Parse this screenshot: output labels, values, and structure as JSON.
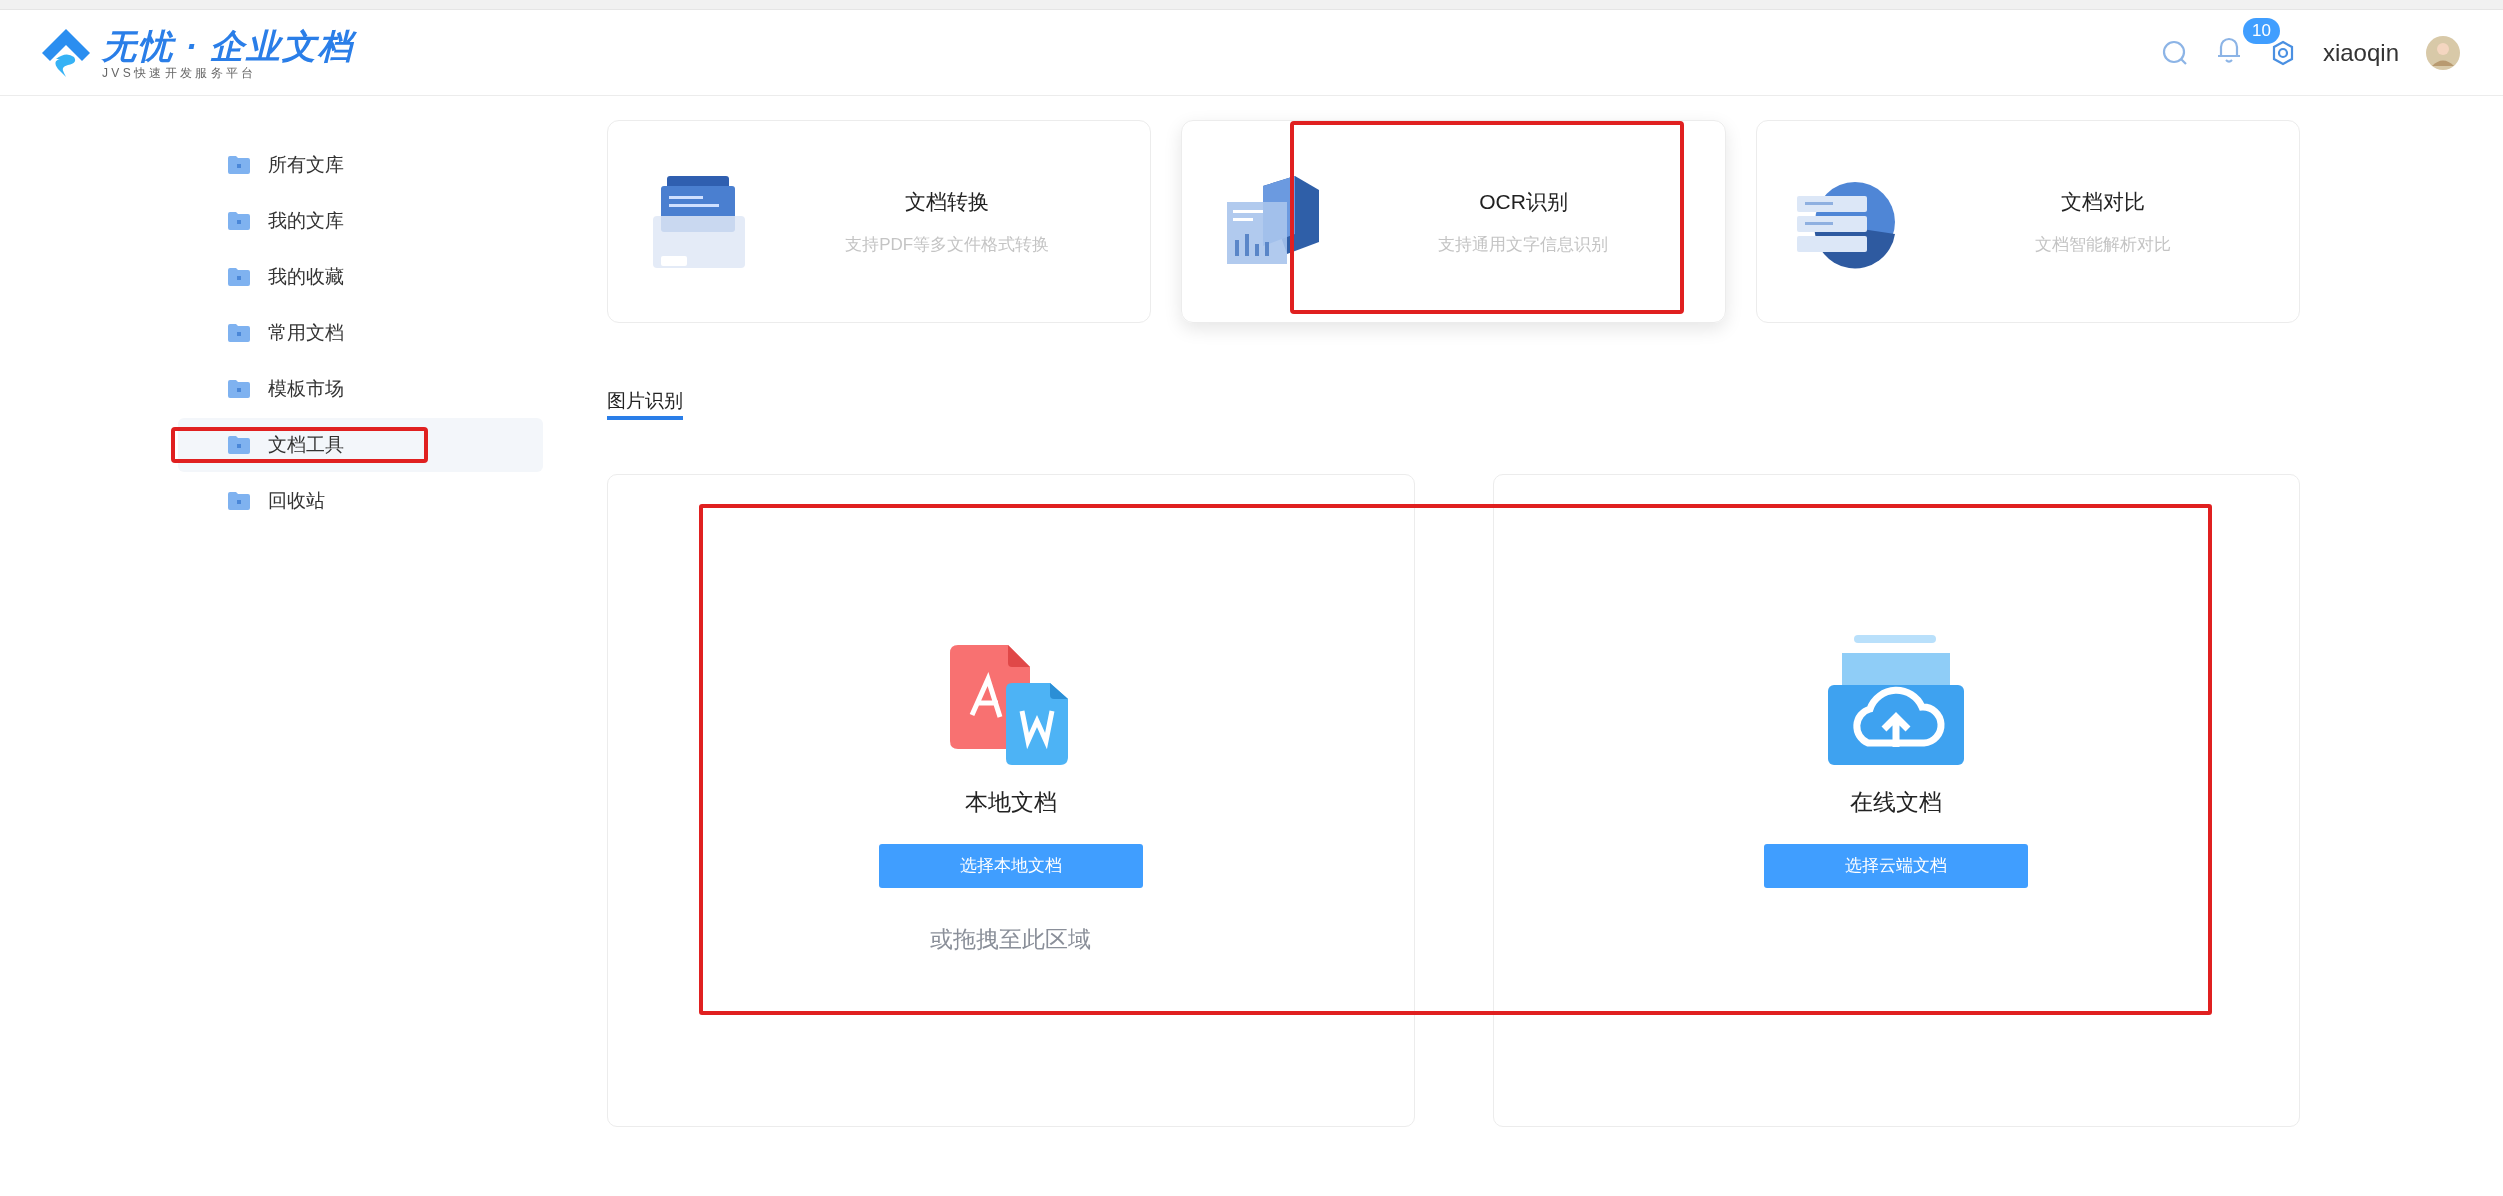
{
  "header": {
    "logo_title": "无忧 · 企业文档",
    "logo_subtitle": "J V S 快 速 开 发 服 务 平 台",
    "notification_count": "10",
    "username": "xiaoqin"
  },
  "sidebar": {
    "items": [
      {
        "label": "所有文库",
        "selected": false,
        "highlighted": false
      },
      {
        "label": "我的文库",
        "selected": false,
        "highlighted": false
      },
      {
        "label": "我的收藏",
        "selected": false,
        "highlighted": false
      },
      {
        "label": "常用文档",
        "selected": false,
        "highlighted": false
      },
      {
        "label": "模板市场",
        "selected": false,
        "highlighted": false
      },
      {
        "label": "文档工具",
        "selected": true,
        "highlighted": true
      },
      {
        "label": "回收站",
        "selected": false,
        "highlighted": false
      }
    ]
  },
  "tools": [
    {
      "kind": "convert",
      "title": "文档转换",
      "subtitle": "支持PDF等多文件格式转换",
      "highlighted": false,
      "selected": false
    },
    {
      "kind": "ocr",
      "title": "OCR识别",
      "subtitle": "支持通用文字信息识别",
      "highlighted": true,
      "selected": true
    },
    {
      "kind": "compare",
      "title": "文档对比",
      "subtitle": "文档智能解析对比",
      "highlighted": false,
      "selected": false
    }
  ],
  "tabs": [
    {
      "label": "图片识别",
      "selected": true
    }
  ],
  "upload": {
    "highlighted": true,
    "sources": [
      {
        "kind": "local",
        "title": "本地文档",
        "button": "选择本地文档",
        "hint": "或拖拽至此区域"
      },
      {
        "kind": "cloud",
        "title": "在线文档",
        "button": "选择云端文档"
      }
    ]
  }
}
